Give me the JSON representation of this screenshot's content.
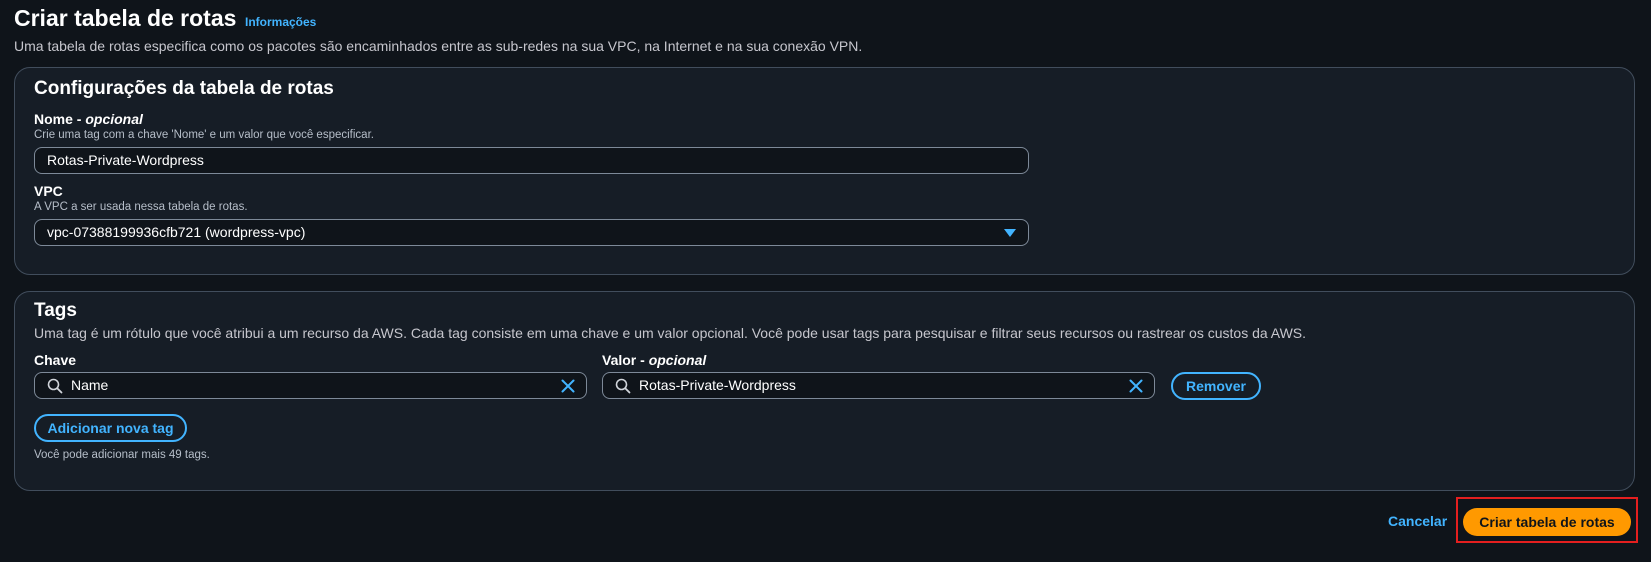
{
  "header": {
    "title": "Criar tabela de rotas",
    "info_link": "Informações",
    "description": "Uma tabela de rotas especifica como os pacotes são encaminhados entre as sub-redes na sua VPC, na Internet e na sua conexão VPN."
  },
  "config": {
    "heading": "Configurações da tabela de rotas",
    "name_label": "Nome - ",
    "name_optional": "opcional",
    "name_hint": "Crie uma tag com a chave 'Nome' e um valor que você especificar.",
    "name_value": "Rotas-Private-Wordpress",
    "vpc_label": "VPC",
    "vpc_hint": "A VPC a ser usada nessa tabela de rotas.",
    "vpc_value": "vpc-07388199936cfb721 (wordpress-vpc)"
  },
  "tags": {
    "heading": "Tags",
    "description": "Uma tag é um rótulo que você atribui a um recurso da AWS. Cada tag consiste em uma chave e um valor opcional. Você pode usar tags para pesquisar e filtrar seus recursos ou rastrear os custos da AWS.",
    "key_label": "Chave",
    "value_label": "Valor - ",
    "value_optional": "opcional",
    "key_value": "Name",
    "value_value": "Rotas-Private-Wordpress",
    "remove_label": "Remover",
    "add_label": "Adicionar nova tag",
    "remaining_hint": "Você pode adicionar mais 49 tags."
  },
  "footer": {
    "cancel_label": "Cancelar",
    "create_label": "Criar tabela de rotas"
  },
  "colors": {
    "accent": "#42b4ff",
    "primary": "#ff9900",
    "highlight": "#e41f1f",
    "background": "#0f141a"
  }
}
